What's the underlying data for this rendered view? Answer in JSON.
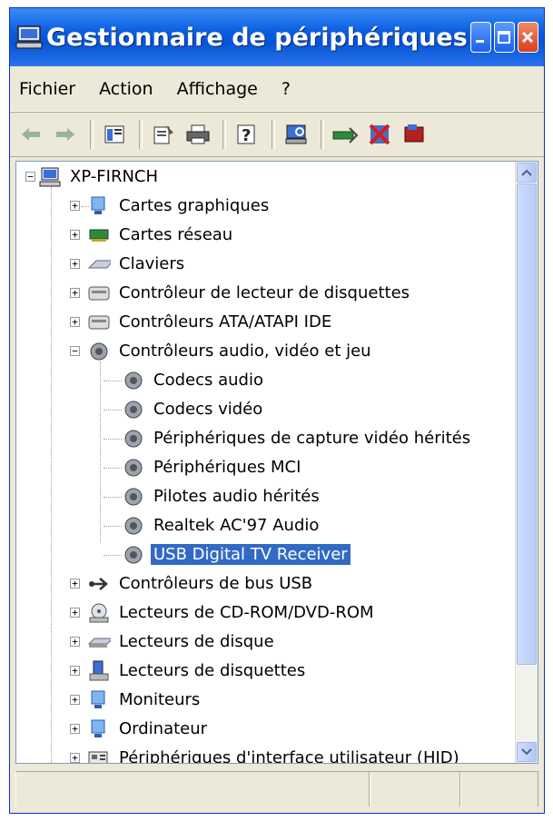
{
  "window": {
    "title": "Gestionnaire de périphériques"
  },
  "menu": {
    "items": [
      "Fichier",
      "Action",
      "Affichage",
      "?"
    ]
  },
  "tree": {
    "root": "XP-FIRNCH",
    "categories": [
      "Cartes graphiques",
      "Cartes réseau",
      "Claviers",
      "Contrôleur de lecteur de disquettes",
      "Contrôleurs ATA/ATAPI IDE",
      "Contrôleurs audio, vidéo et jeu"
    ],
    "audio_children": [
      "Codecs audio",
      "Codecs vidéo",
      "Périphériques de capture vidéo hérités",
      "Périphériques MCI",
      "Pilotes audio hérités",
      "Realtek AC'97 Audio",
      "USB Digital TV Receiver"
    ],
    "more_categories": [
      "Contrôleurs de bus USB",
      "Lecteurs de CD-ROM/DVD-ROM",
      "Lecteurs de disque",
      "Lecteurs de disquettes",
      "Moniteurs",
      "Ordinateur",
      "Périphériques d'interface utilisateur (HID)"
    ],
    "selected": "USB Digital TV Receiver"
  },
  "colors": {
    "title_blue": "#0553d6",
    "selection": "#316ac5",
    "close_red": "#d6401a"
  }
}
